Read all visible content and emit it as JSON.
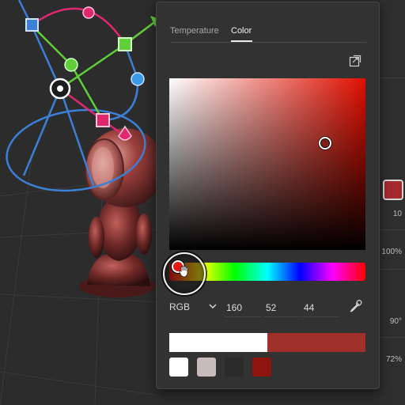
{
  "popover": {
    "tabs": [
      {
        "label": "Temperature",
        "active": false
      },
      {
        "label": "Color",
        "active": true
      }
    ],
    "export_icon": "export-icon",
    "color_field": {
      "hue_color": "#e00f00",
      "handle_color": "#7e2019"
    },
    "hue_slider": {
      "handle_color": "#e41a12",
      "hand_icon": "hand-cursor-icon"
    },
    "mode": {
      "label": "RGB",
      "options_icon": "chevron-down-icon"
    },
    "rgb": {
      "r": "160",
      "g": "52",
      "b": "44"
    },
    "eyedropper_icon": "eyedropper-icon",
    "compare": {
      "previous_color": "#ffffff",
      "current_color": "#a0302c"
    },
    "swatches": [
      "#ffffff",
      "#c8bcbd",
      "#2a2a2a",
      "#8e1410"
    ]
  },
  "properties": {
    "swatch_color": "#a22a2e",
    "values": [
      "10",
      "100%",
      "90°",
      "72%"
    ]
  },
  "colors": {
    "blue_widget": "#3b7fd6",
    "green_widget": "#5fcf3a",
    "pink_widget": "#e0286f"
  }
}
